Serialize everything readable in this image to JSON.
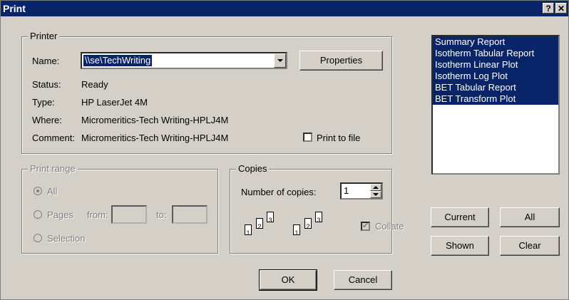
{
  "window": {
    "title": "Print",
    "help_label": "?",
    "close_label": "✕"
  },
  "printer": {
    "group_label": "Printer",
    "name_label": "Name:",
    "name_value": "\\\\se\\TechWriting",
    "properties_label": "Properties",
    "status_label": "Status:",
    "status_value": "Ready",
    "type_label": "Type:",
    "type_value": "HP LaserJet 4M",
    "where_label": "Where:",
    "where_value": "Micromeritics-Tech Writing-HPLJ4M",
    "comment_label": "Comment:",
    "comment_value": "Micromeritics-Tech Writing-HPLJ4M",
    "print_to_file_label": "Print to file"
  },
  "print_range": {
    "group_label": "Print range",
    "all_label": "All",
    "pages_label": "Pages",
    "from_label": "from:",
    "to_label": "to:",
    "selection_label": "Selection"
  },
  "copies": {
    "group_label": "Copies",
    "number_label": "Number of copies:",
    "number_value": "1",
    "collate_label": "Collate",
    "page_numbers": [
      "1",
      "2",
      "3"
    ]
  },
  "reports": {
    "items": [
      "Summary Report",
      "Isotherm Tabular Report",
      "Isotherm Linear Plot",
      "Isotherm Log Plot",
      "BET Tabular Report",
      "BET Transform Plot"
    ],
    "current_label": "Current",
    "all_label": "All",
    "shown_label": "Shown",
    "clear_label": "Clear"
  },
  "actions": {
    "ok_label": "OK",
    "cancel_label": "Cancel"
  }
}
